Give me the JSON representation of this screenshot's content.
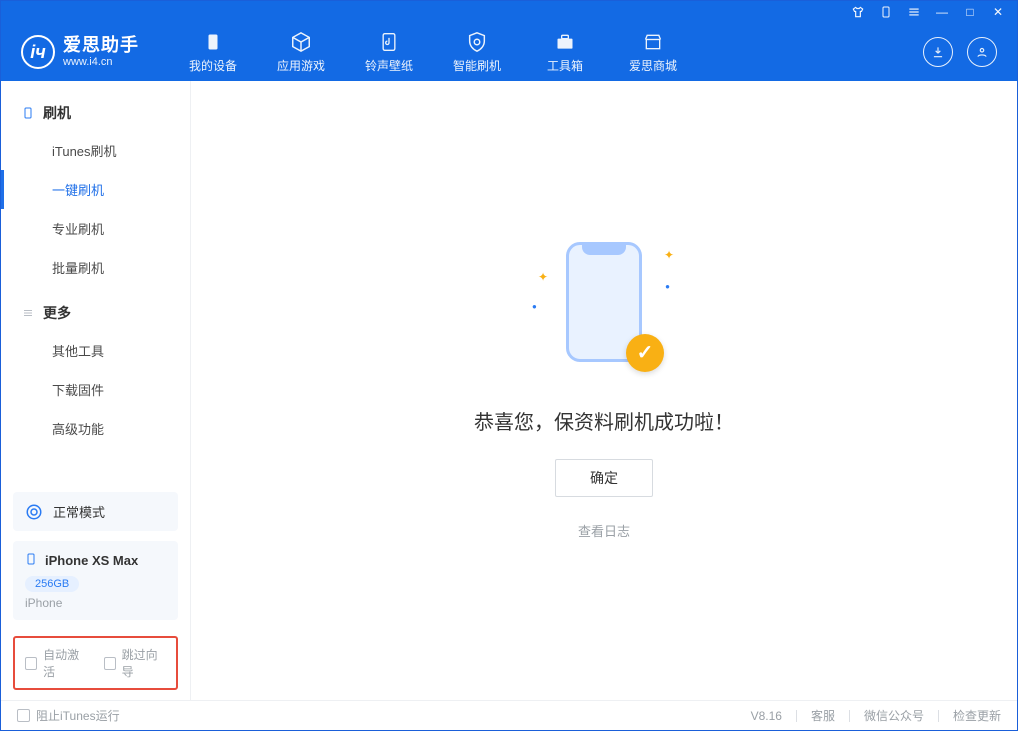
{
  "titlebar_icons": {
    "tshirt": "👕",
    "phone": "📱",
    "menu": "≡",
    "minimize": "—",
    "maximize": "□",
    "close": "✕"
  },
  "logo": {
    "cn": "爱思助手",
    "en": "www.i4.cn"
  },
  "nav": {
    "device": "我的设备",
    "apps": "应用游戏",
    "ringtones": "铃声壁纸",
    "flash": "智能刷机",
    "tools": "工具箱",
    "store": "爱思商城"
  },
  "sidebar": {
    "group_flash": "刷机",
    "items_flash": [
      "iTunes刷机",
      "一键刷机",
      "专业刷机",
      "批量刷机"
    ],
    "group_more": "更多",
    "items_more": [
      "其他工具",
      "下载固件",
      "高级功能"
    ],
    "mode": "正常模式",
    "device_name": "iPhone XS Max",
    "device_storage": "256GB",
    "device_type": "iPhone",
    "auto_activate": "自动激活",
    "skip_guide": "跳过向导"
  },
  "main": {
    "success_text": "恭喜您，保资料刷机成功啦！",
    "confirm": "确定",
    "view_log": "查看日志"
  },
  "footer": {
    "block_itunes": "阻止iTunes运行",
    "version": "V8.16",
    "cs": "客服",
    "wechat": "微信公众号",
    "update": "检查更新"
  },
  "colors": {
    "primary": "#136ae4",
    "accent": "#f9b014"
  }
}
